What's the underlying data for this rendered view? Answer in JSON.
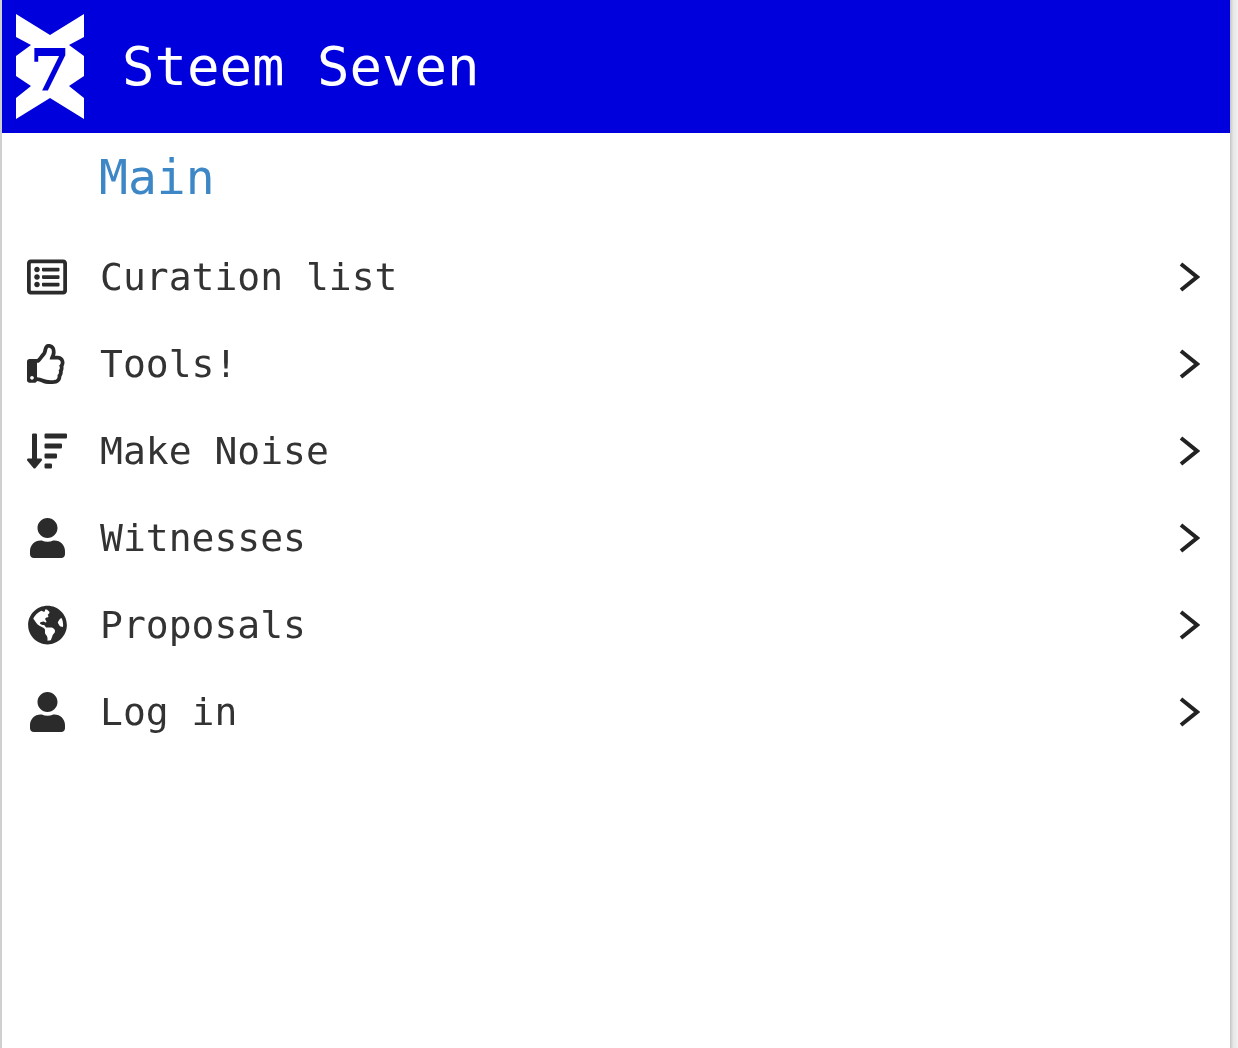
{
  "header": {
    "logo_mark": "7",
    "title": "Steem Seven"
  },
  "section": {
    "title": "Main"
  },
  "menu": {
    "items": [
      {
        "label": "Curation list"
      },
      {
        "label": "Tools!"
      },
      {
        "label": "Make Noise"
      },
      {
        "label": "Witnesses"
      },
      {
        "label": "Proposals"
      },
      {
        "label": "Log in"
      }
    ]
  }
}
